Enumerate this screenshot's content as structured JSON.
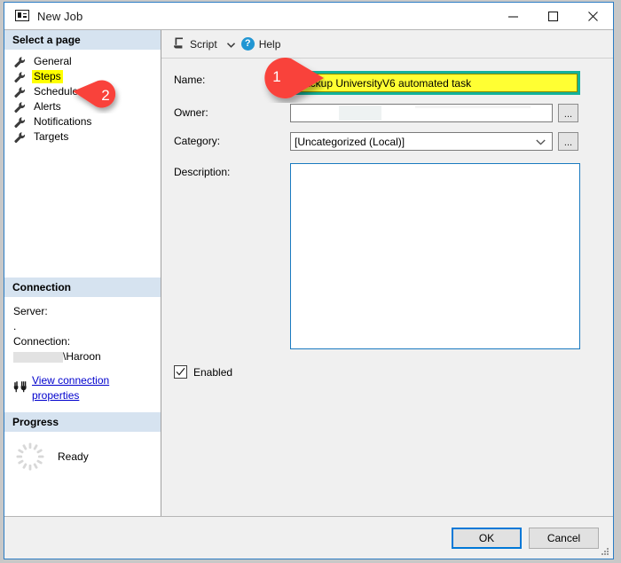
{
  "window": {
    "title": "New Job",
    "icon": "new-job-icon",
    "controls": {
      "minimize": "minimize-icon",
      "maximize": "maximize-icon",
      "close": "close-icon"
    }
  },
  "sidebar": {
    "header": "Select a page",
    "items": [
      {
        "label": "General",
        "selected": false,
        "icon": "wrench-icon"
      },
      {
        "label": "Steps",
        "selected": true,
        "icon": "wrench-icon"
      },
      {
        "label": "Schedules",
        "selected": false,
        "icon": "wrench-icon"
      },
      {
        "label": "Alerts",
        "selected": false,
        "icon": "wrench-icon"
      },
      {
        "label": "Notifications",
        "selected": false,
        "icon": "wrench-icon"
      },
      {
        "label": "Targets",
        "selected": false,
        "icon": "wrench-icon"
      }
    ]
  },
  "connection": {
    "header": "Connection",
    "server_label": "Server:",
    "server_value": ".",
    "connection_label": "Connection:",
    "connection_value": "\\Haroon",
    "view_properties_link": "View connection properties",
    "link_icon": "connection-properties-icon"
  },
  "progress": {
    "header": "Progress",
    "status": "Ready",
    "icon": "spinner-icon"
  },
  "toolbar": {
    "script_label": "Script",
    "script_icon": "script-icon",
    "script_caret": "chevron-down-icon",
    "help_label": "Help",
    "help_icon": "help-question-icon"
  },
  "form": {
    "name_label": "Name:",
    "name_value": "Backup UniversityV6 automated task",
    "owner_label": "Owner:",
    "owner_value": "",
    "owner_browse": "...",
    "category_label": "Category:",
    "category_value": "[Uncategorized (Local)]",
    "category_browse": "...",
    "category_caret": "chevron-down-icon",
    "description_label": "Description:",
    "description_value": "",
    "enabled_label": "Enabled",
    "enabled_checked": true
  },
  "footer": {
    "ok_label": "OK",
    "cancel_label": "Cancel"
  },
  "callouts": [
    {
      "number": "1",
      "points": "right",
      "target": "name-input"
    },
    {
      "number": "2",
      "points": "left",
      "target": "sidebar-item-steps"
    }
  ],
  "colors": {
    "highlight_yellow": "#ffff33",
    "callout_red": "#f9423a",
    "accent_teal": "#12b29b",
    "accent_blue": "#0078d7",
    "link_blue": "#0000cd",
    "section_header_blue": "#d6e3f0"
  }
}
